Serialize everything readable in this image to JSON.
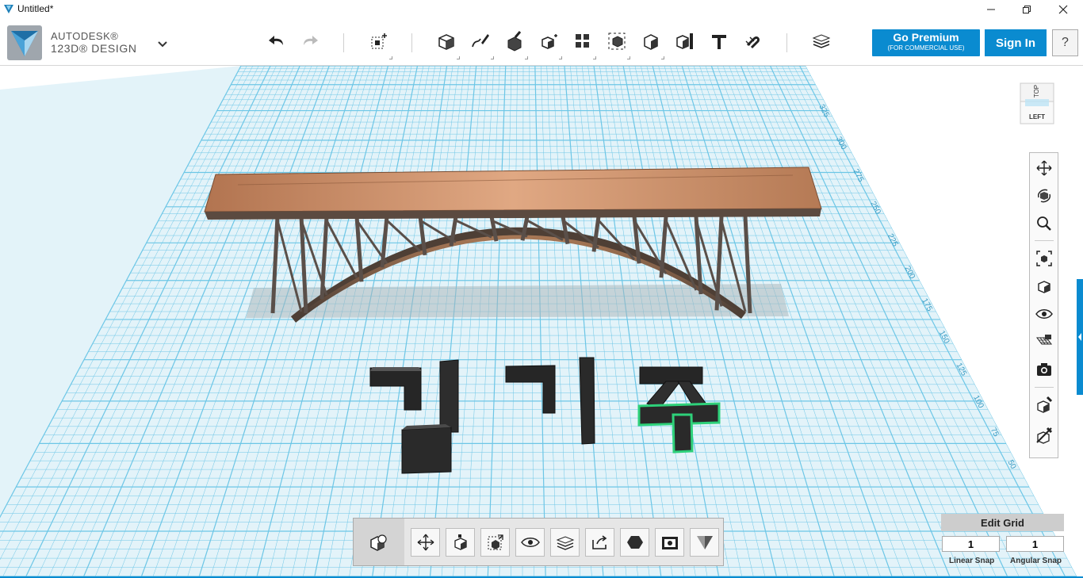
{
  "window": {
    "title": "Untitled*"
  },
  "brand": {
    "line1": "AUTODESK®",
    "line2": "123D® DESIGN"
  },
  "header": {
    "premium_label": "Go Premium",
    "premium_sub": "(FOR COMMERCIAL USE)",
    "signin_label": "Sign In",
    "help_label": "?"
  },
  "viewcube": {
    "top_face": "TOP",
    "front_face": "LEFT"
  },
  "ruler": {
    "ticks": [
      "50",
      "75",
      "100",
      "125",
      "150",
      "175",
      "200",
      "225",
      "250",
      "275",
      "300",
      "325"
    ]
  },
  "grid": {
    "edit_label": "Edit Grid",
    "linear_snap_value": "1",
    "linear_snap_label": "Linear Snap",
    "angular_snap_value": "1",
    "angular_snap_label": "Angular Snap"
  },
  "colors": {
    "accent": "#0a8bd0",
    "grid_background": "#e3f3f9",
    "grid_line": "#6cc6e6",
    "deck": "#cf9169",
    "arch": "#5a4f49",
    "selection": "#2ed17a"
  }
}
